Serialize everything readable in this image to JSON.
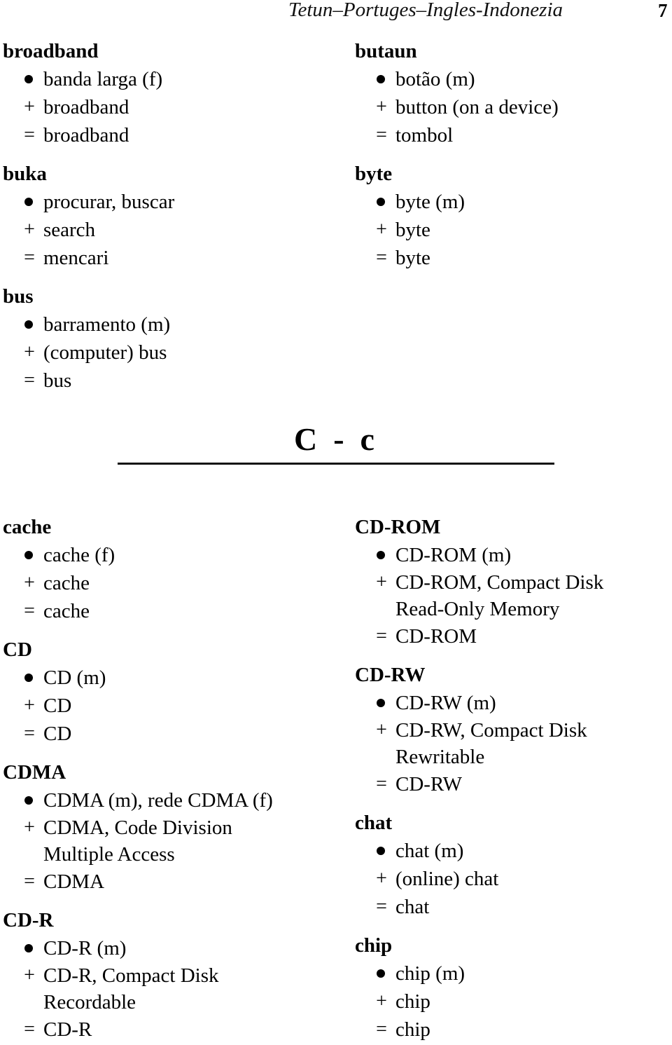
{
  "header": {
    "title": "Tetun–Portuges–Ingles-Indonezia",
    "page_number": "7"
  },
  "markers": {
    "portuguese": "•",
    "english": "+",
    "indonesian": "="
  },
  "top_left": [
    {
      "term": "broadband",
      "pt": "banda larga (f)",
      "en": "broadband",
      "id": "broadband"
    },
    {
      "term": "buka",
      "pt": "procurar, buscar",
      "en": "search",
      "id": "mencari"
    },
    {
      "term": "bus",
      "pt": "barramento (m)",
      "en": "(computer) bus",
      "id": "bus"
    }
  ],
  "top_right": [
    {
      "term": "butaun",
      "pt": "botão (m)",
      "en": "button (on a device)",
      "id": "tombol"
    },
    {
      "term": "byte",
      "pt": "byte (m)",
      "en": "byte",
      "id": "byte"
    }
  ],
  "section": {
    "title": "C  -  c"
  },
  "bottom_left": [
    {
      "term": "cache",
      "pt": "cache (f)",
      "en": "cache",
      "id": "cache"
    },
    {
      "term": "CD",
      "pt": "CD (m)",
      "en": "CD",
      "id": "CD"
    },
    {
      "term": "CDMA",
      "pt": "CDMA (m), rede CDMA (f)",
      "en": "CDMA, Code Division Multiple Access",
      "id": "CDMA"
    },
    {
      "term": "CD-R",
      "pt": "CD-R (m)",
      "en": "CD-R, Compact Disk Recordable",
      "id": "CD-R"
    }
  ],
  "bottom_right": [
    {
      "term": "CD-ROM",
      "pt": "CD-ROM (m)",
      "en": "CD-ROM, Compact Disk Read-Only Memory",
      "id": "CD-ROM"
    },
    {
      "term": "CD-RW",
      "pt": "CD-RW (m)",
      "en": "CD-RW, Compact Disk Rewritable",
      "id": "CD-RW"
    },
    {
      "term": "chat",
      "pt": "chat (m)",
      "en": "(online) chat",
      "id": "chat"
    },
    {
      "term": "chip",
      "pt": "chip (m)",
      "en": "chip",
      "id": "chip"
    }
  ]
}
